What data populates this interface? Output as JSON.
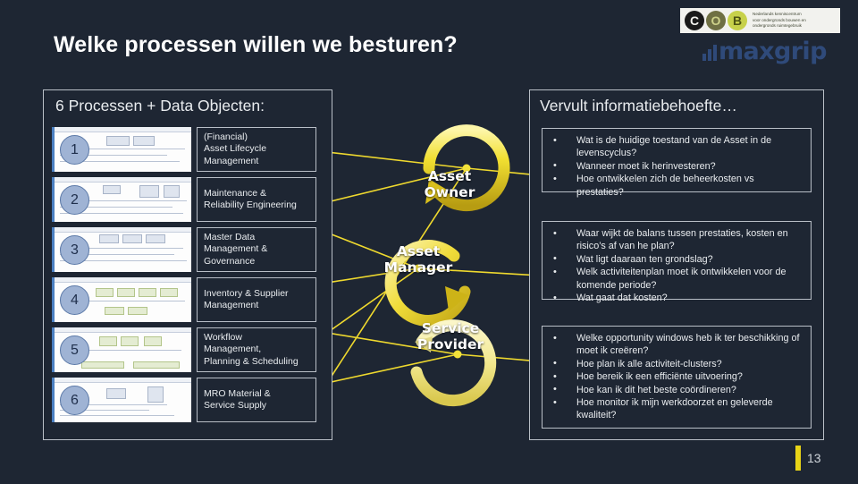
{
  "slide": {
    "title": "Welke processen willen we besturen?",
    "page_number": "13",
    "background_color": "#1e2633",
    "accent_color": "#e8d417"
  },
  "logos": {
    "cob": {
      "letters": [
        "C",
        "O",
        "B"
      ],
      "tagline_lines": [
        "Nederlands kenniscentrum",
        "voor ondergronds bouwen en",
        "ondergronds ruimtegebruik"
      ]
    },
    "maxgrip": {
      "wordmark": "maxgrip",
      "color": "#2f4a7a"
    }
  },
  "left_panel": {
    "heading": "6 Processen + Data Objecten:",
    "processes": [
      {
        "number": "1",
        "label": "(Financial)\nAsset Lifecycle\nManagement",
        "lines": [
          "(Financial)",
          "Asset Lifecycle",
          "Management"
        ]
      },
      {
        "number": "2",
        "label": "Maintenance &\nReliability Engineering",
        "lines": [
          "Maintenance &",
          "Reliability Engineering"
        ]
      },
      {
        "number": "3",
        "label": "Master Data\nManagement &\nGovernance",
        "lines": [
          "Master Data",
          "Management &",
          "Governance"
        ]
      },
      {
        "number": "4",
        "label": "Inventory & Supplier\nManagement",
        "lines": [
          "Inventory & Supplier",
          "Management"
        ]
      },
      {
        "number": "5",
        "label": "Workflow\nManagement,\nPlanning & Scheduling",
        "lines": [
          "Workflow",
          "Management,",
          "Planning & Scheduling"
        ]
      },
      {
        "number": "6",
        "label": "MRO Material &\nService Supply",
        "lines": [
          "MRO Material &",
          "Service Supply"
        ]
      }
    ]
  },
  "center_diagram": {
    "roles": [
      {
        "name": "Asset Owner",
        "lines": [
          "Asset",
          "Owner"
        ]
      },
      {
        "name": "Asset Manager",
        "lines": [
          "Asset",
          "Manager"
        ]
      },
      {
        "name": "Service Provider",
        "lines": [
          "Service",
          "Provider"
        ]
      }
    ],
    "arrow_color": "#f2e032"
  },
  "right_panel": {
    "heading": "Vervult informatiebehoefte…",
    "groups": [
      {
        "role": "Asset Owner",
        "questions": [
          "Wat is de huidige toestand van de Asset in de levenscyclus?",
          "Wanneer moet ik herinvesteren?",
          "Hoe ontwikkelen zich de beheerkosten vs prestaties?"
        ]
      },
      {
        "role": "Asset Manager",
        "questions": [
          "Waar wijkt de balans tussen prestaties, kosten en risico’s af van he plan?",
          "Wat ligt daaraan ten grondslag?",
          "Welk activiteitenplan moet ik ontwikkelen voor de komende periode?",
          "Wat gaat dat kosten?"
        ]
      },
      {
        "role": "Service Provider",
        "questions": [
          "Welke opportunity windows heb ik ter beschikking of moet ik creëren?",
          "Hoe plan ik alle activiteit-clusters?",
          "Hoe bereik ik een efficiënte uitvoering?",
          "Hoe kan ik dit het beste coördineren?",
          "Hoe monitor ik mijn werkdoorzet en geleverde kwaliteit?"
        ]
      }
    ]
  }
}
